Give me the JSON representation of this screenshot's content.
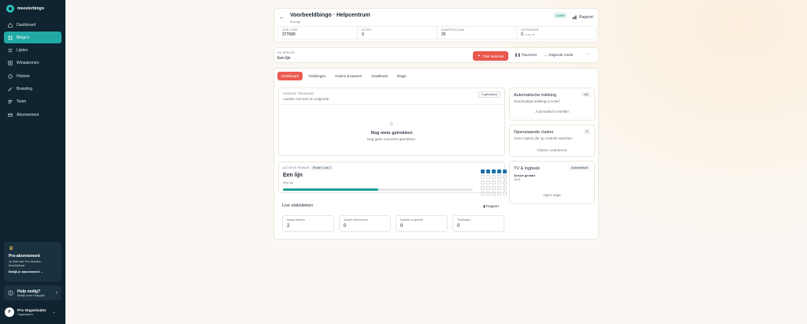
{
  "brand": {
    "name": "meesterbingo"
  },
  "sidebar": {
    "items": [
      {
        "label": "Dashboard",
        "icon": "home-icon"
      },
      {
        "label": "Bingo's",
        "icon": "grid-icon",
        "active": true
      },
      {
        "label": "Lijsten",
        "icon": "list-icon"
      },
      {
        "label": "Winpatronen",
        "icon": "pattern-icon"
      },
      {
        "label": "Historie",
        "icon": "clock-icon"
      },
      {
        "label": "Branding",
        "icon": "brush-icon"
      },
      {
        "label": "Team",
        "icon": "users-icon"
      },
      {
        "label": "Abonnement",
        "icon": "card-icon"
      }
    ],
    "pro": {
      "title": "Pro-abonnement",
      "desc": "Je hebt alle Pro-functies beschikbaar.",
      "link": "Bekijk je abonnement →"
    },
    "help": {
      "title": "Hulp nodig?",
      "sub": "Bekijk onze helpgids"
    },
    "user": {
      "initial": "P",
      "name": "Pro Organisator",
      "role": "Organisator"
    }
  },
  "header": {
    "title": "Voorbeeldbingo · Helpcentrum",
    "subtitle": "Een lijn",
    "status": "Actief",
    "report": "Rapport",
    "stats": [
      {
        "label": "JOIN CODE",
        "value": "377690"
      },
      {
        "label": "ACTIEF",
        "value": "0"
      },
      {
        "label": "KAARTEN/CLAIM",
        "value": "25"
      },
      {
        "label": "GETROKKEN",
        "value": "0",
        "badge": "0 van 75"
      }
    ]
  },
  "now_playing": {
    "label": "NU SPELEN",
    "value": "Een lijn",
    "draw_button": "Trek nummer",
    "pause_button": "Pauzeren",
    "next_button": "Volgende ronde",
    "more": "···"
  },
  "tabs": [
    "Dashboard",
    "Trekkingen",
    "Claims & kaarten",
    "Draaiboek",
    "Regie"
  ],
  "last_draw": {
    "label": "HUIDIGE TREKKING",
    "sub": "Laatste nummer en volgende.",
    "count": "0 getrokken",
    "empty_title": "Nog niets getrokken",
    "empty_sub": "Nog geen nummers getrokken."
  },
  "active_round": {
    "label": "ACTIEVE RONDE",
    "badge": "Ronde 1 van 2",
    "title": "Een lijn",
    "sub": "Een lijn",
    "progress": 0.5,
    "grid_on": [
      0,
      1,
      2,
      3,
      4
    ]
  },
  "live_stats": {
    "title": "Live statistieken",
    "report": "Rapport",
    "items": [
      {
        "label": "Aantal kaarten",
        "value": "2"
      },
      {
        "label": "Actieve deelnemers",
        "value": "0"
      },
      {
        "label": "Kaarten in gebruik",
        "value": "0"
      },
      {
        "label": "Trekkingen",
        "value": "0"
      }
    ]
  },
  "side_auto": {
    "title": "Automatische trekking",
    "tag": "Uit",
    "desc": "Handmatige trekking is actief.",
    "link": "Automatisch instellen"
  },
  "side_claims": {
    "title": "Openstaande claims",
    "tag": "0",
    "desc": "Geen claims die op controle wachten.",
    "link": "Claims controleren"
  },
  "side_tv": {
    "title": "TV & logboek",
    "tag": "Automatisch",
    "line1": "Sessie gestart",
    "line2": "16:21",
    "link": "Open regie"
  }
}
